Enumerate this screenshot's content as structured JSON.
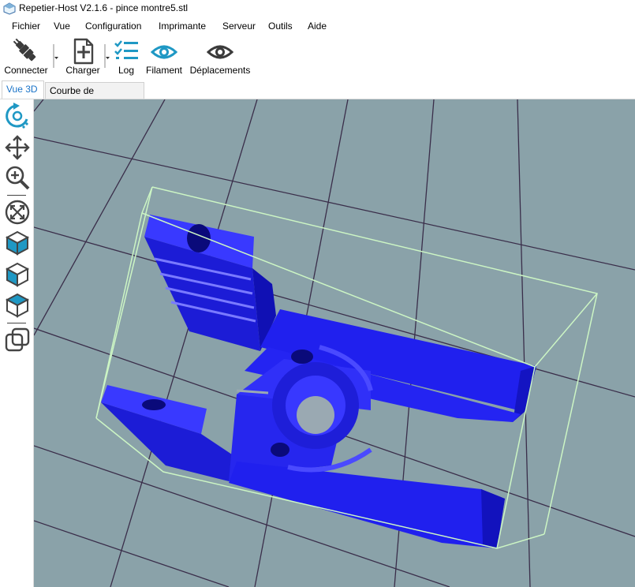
{
  "window": {
    "title": "Repetier-Host V2.1.6 - pince montre5.stl"
  },
  "menu": [
    "Fichier",
    "Vue",
    "Configuration",
    "Imprimante",
    "Serveur",
    "Outils",
    "Aide"
  ],
  "toolbar": {
    "connect": "Connecter",
    "load": "Charger",
    "log": "Log",
    "filament": "Filament",
    "moves": "Déplacements"
  },
  "tabs": {
    "view3d": "Vue 3D",
    "temp": "Courbe de Température"
  },
  "sidebar": {
    "icons": [
      "rotate-icon",
      "move-icon",
      "zoom-icon",
      "fit-view-icon",
      "cube-front-icon",
      "cube-side-icon",
      "cube-top-icon",
      "overlap-icon"
    ]
  },
  "colors": {
    "accent": "#1f98c4",
    "viewport_bg": "#8aa2a9",
    "grid": "#3a2e4a",
    "model": "#1f1ff0",
    "bbox": "#ccf5c4"
  }
}
